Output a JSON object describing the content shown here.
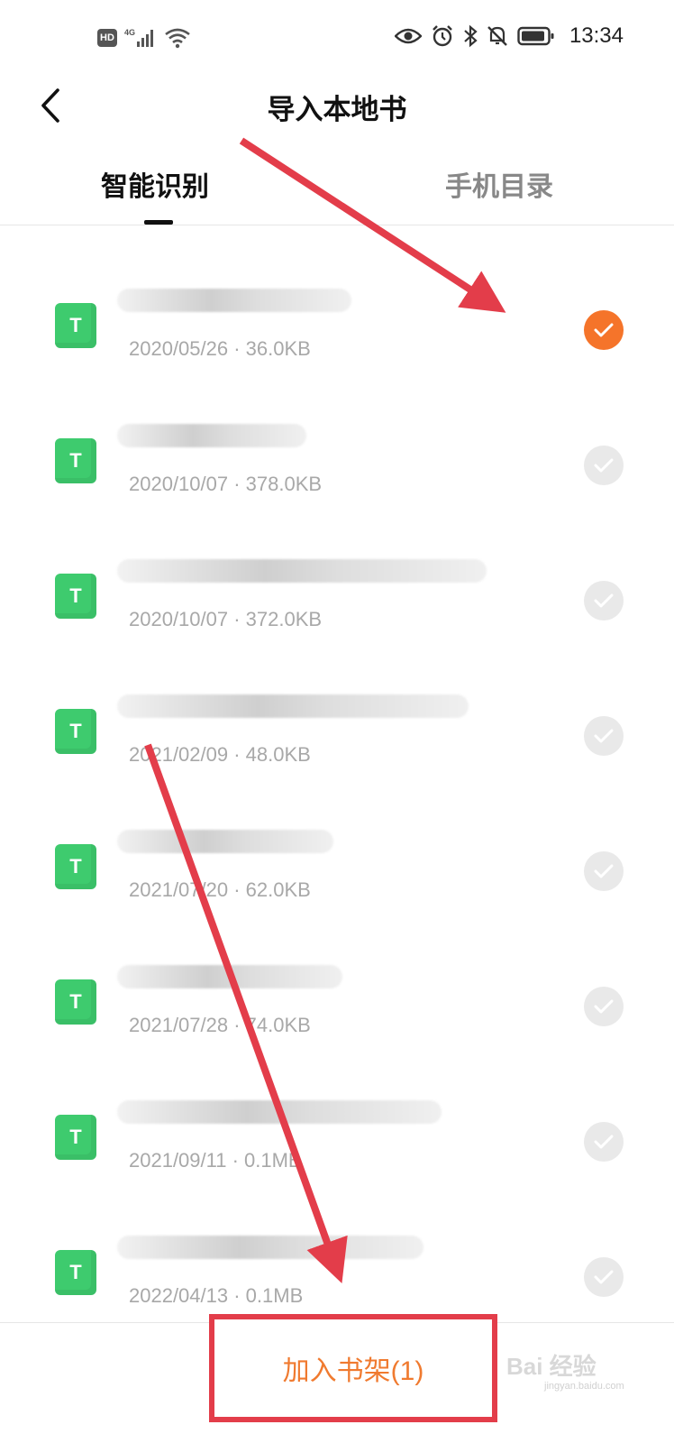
{
  "status_bar": {
    "hd_badge": "HD",
    "network": "4G",
    "time": "13:34"
  },
  "nav": {
    "title": "导入本地书"
  },
  "tabs": [
    {
      "label": "智能识别",
      "active": true
    },
    {
      "label": "手机目录",
      "active": false
    }
  ],
  "files": [
    {
      "icon_letter": "T",
      "name": "",
      "meta": "2020/05/26 · 36.0KB",
      "selected": true
    },
    {
      "icon_letter": "T",
      "name": "",
      "meta": "2020/10/07 · 378.0KB",
      "selected": false
    },
    {
      "icon_letter": "T",
      "name": "",
      "meta": "2020/10/07 · 372.0KB",
      "selected": false
    },
    {
      "icon_letter": "T",
      "name": "",
      "meta": "2021/02/09 · 48.0KB",
      "selected": false
    },
    {
      "icon_letter": "T",
      "name": "",
      "meta": "2021/07/20 · 62.0KB",
      "selected": false
    },
    {
      "icon_letter": "T",
      "name": "",
      "meta": "2021/07/28 · 74.0KB",
      "selected": false
    },
    {
      "icon_letter": "T",
      "name": "",
      "meta": "2021/09/11 · 0.1MB",
      "selected": false
    },
    {
      "icon_letter": "T",
      "name": "",
      "meta": "2022/04/13 · 0.1MB",
      "selected": false
    }
  ],
  "bottom": {
    "add_label": "加入书架(1)",
    "watermark": "Bai 经验",
    "watermark_sub": "jingyan.baidu.com"
  },
  "colors": {
    "accent": "#f07a2f",
    "check_selected": "#f5742a",
    "check_unselected": "#e9e9e9",
    "file_icon": "#3ecb6e",
    "annotation": "#e33d4a"
  }
}
